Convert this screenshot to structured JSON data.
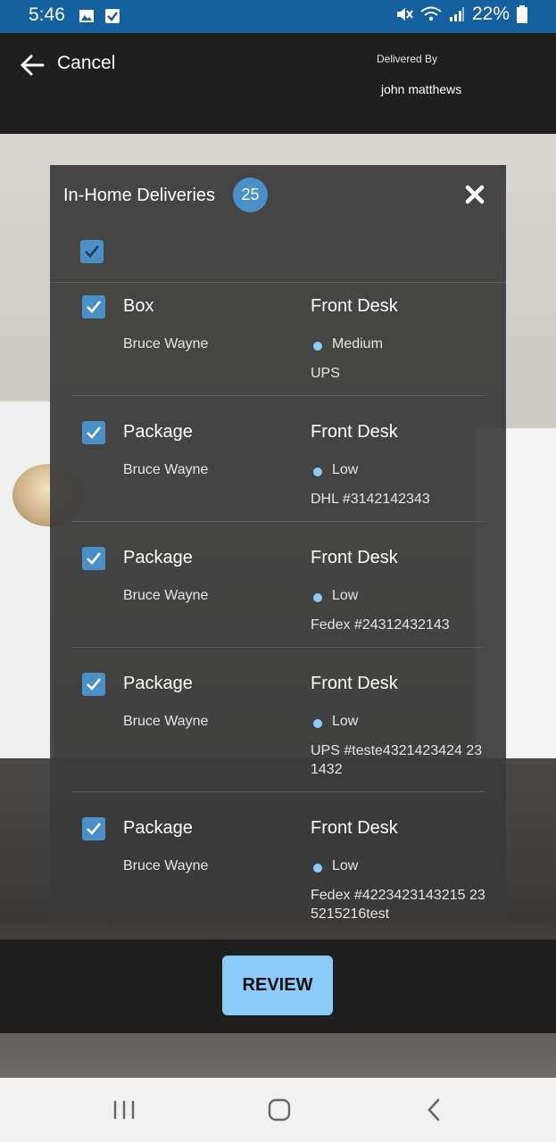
{
  "status_bar": {
    "time": "5:46",
    "battery": "22%"
  },
  "header": {
    "cancel_label": "Cancel",
    "delivered_by_label": "Delivered By",
    "delivered_by_name": "john matthews"
  },
  "modal": {
    "title": "In-Home Deliveries",
    "count": "25",
    "items": [
      {
        "type": "Box",
        "recipient": "Bruce Wayne",
        "location": "Front Desk",
        "priority": "Medium",
        "carrier": "UPS"
      },
      {
        "type": "Package",
        "recipient": "Bruce Wayne",
        "location": "Front Desk",
        "priority": "Low",
        "carrier": "DHL #3142142343"
      },
      {
        "type": "Package",
        "recipient": "Bruce Wayne",
        "location": "Front Desk",
        "priority": "Low",
        "carrier": "Fedex #24312432143"
      },
      {
        "type": "Package",
        "recipient": "Bruce Wayne",
        "location": "Front Desk",
        "priority": "Low",
        "carrier": "UPS #teste4321423424 231432"
      },
      {
        "type": "Package",
        "recipient": "Bruce Wayne",
        "location": "Front Desk",
        "priority": "Low",
        "carrier": "Fedex #4223423143215 235215216test"
      }
    ]
  },
  "review_label": "REVIEW",
  "colors": {
    "status_bar": "#15609e",
    "accent": "#4a90c6",
    "review_button": "#8ccbf7",
    "priority_dot": "#8ccbf7"
  },
  "icons": [
    "arrow-left-icon",
    "close-icon",
    "checkbox-checked-icon",
    "recents-icon",
    "home-icon",
    "back-icon"
  ]
}
